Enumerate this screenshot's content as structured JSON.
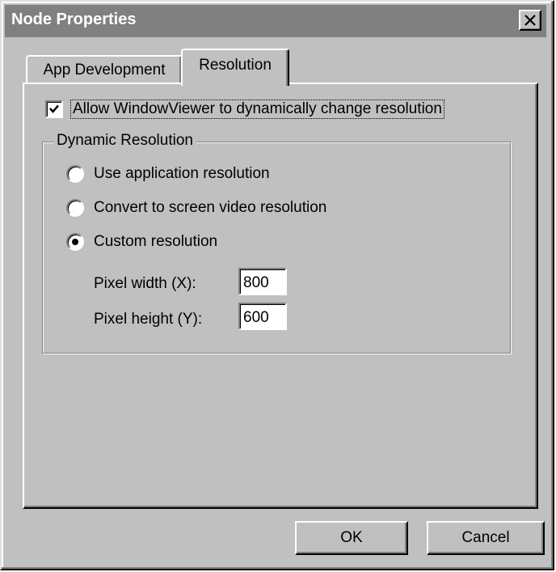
{
  "window": {
    "title": "Node Properties"
  },
  "tabs": [
    {
      "label": "App Development"
    },
    {
      "label": "Resolution"
    }
  ],
  "resolution_tab": {
    "allow_dynamic": {
      "label": "Allow WindowViewer to dynamically change resolution",
      "checked": true
    },
    "group": {
      "label": "Dynamic Resolution",
      "options": [
        {
          "label": "Use application resolution",
          "selected": false
        },
        {
          "label": "Convert to screen video resolution",
          "selected": false
        },
        {
          "label": "Custom resolution",
          "selected": true
        }
      ],
      "pixel_width": {
        "label": "Pixel width (X):",
        "value": "800"
      },
      "pixel_height": {
        "label": "Pixel height (Y):",
        "value": "600"
      }
    }
  },
  "buttons": {
    "ok": "OK",
    "cancel": "Cancel"
  }
}
